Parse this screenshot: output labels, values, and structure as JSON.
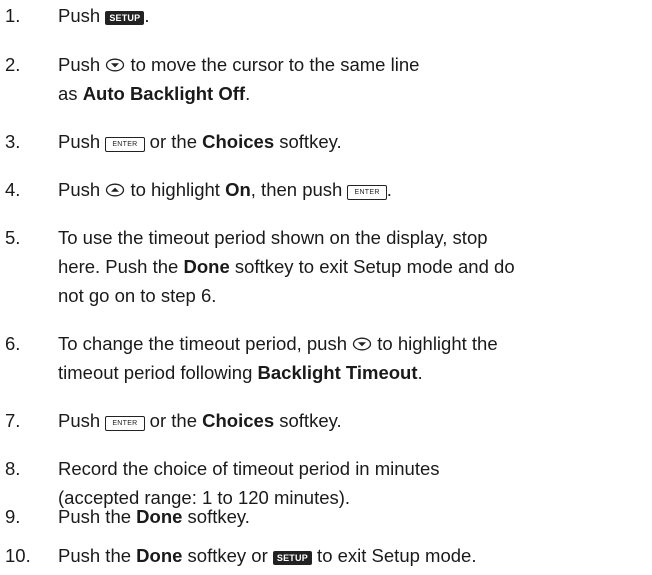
{
  "keys": {
    "setup": "SETUP",
    "enter": "ENTER",
    "down_arrow_icon": "down-arrow-icon",
    "up_arrow_icon": "up-arrow-icon"
  },
  "steps": [
    {
      "number": "1.",
      "t1": "Push ",
      "t2": "."
    },
    {
      "number": "2.",
      "t1": "Push ",
      "t2": " to move the cursor to the same line",
      "t3": "as ",
      "b1": "Auto Backlight Off",
      "t4": "."
    },
    {
      "number": "3.",
      "t1": "Push ",
      "t2": " or the ",
      "b1": "Choices",
      "t3": " softkey."
    },
    {
      "number": "4.",
      "t1": "Push ",
      "t2": " to highlight ",
      "b1": "On",
      "t3": ", then push ",
      "t4": "."
    },
    {
      "number": "5.",
      "l1": "To use the timeout period shown on the display, stop",
      "t1": "here. Push the ",
      "b1": "Done",
      "t2": " softkey to exit Setup mode and do",
      "l3": "not go on to step 6."
    },
    {
      "number": "6.",
      "t1": "To change the timeout period, push ",
      "t2": " to highlight the",
      "t3": "timeout period following ",
      "b1": "Backlight Timeout",
      "t4": "."
    },
    {
      "number": "7.",
      "t1": "Push ",
      "t2": " or the ",
      "b1": "Choices",
      "t3": " softkey."
    },
    {
      "number": "8.",
      "l1": "Record the choice of timeout period in minutes",
      "l2": "(accepted range: 1 to 120 minutes)."
    },
    {
      "number": "9.",
      "t1": "Push the ",
      "b1": "Done",
      "t2": " softkey."
    },
    {
      "number": "10.",
      "t1": "Push the ",
      "b1": "Done",
      "t2": " softkey or ",
      "t3": " to exit Setup mode."
    }
  ]
}
